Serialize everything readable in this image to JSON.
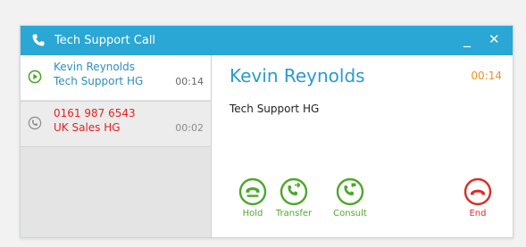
{
  "window": {
    "title": "Tech Support Call",
    "minimize_glyph": "_",
    "close_glyph": "✕"
  },
  "calls": [
    {
      "name": "Kevin Reynolds",
      "department": "Tech Support HG",
      "duration": "00:14",
      "state": "active",
      "icon": "play-circle-icon"
    },
    {
      "name": "0161 987 6543",
      "department": "UK Sales HG",
      "duration": "00:02",
      "state": "on-hold",
      "icon": "call-held-icon"
    }
  ],
  "current_call": {
    "name": "Kevin Reynolds",
    "duration": "00:14",
    "department": "Tech Support HG"
  },
  "actions": {
    "hold": "Hold",
    "transfer": "Transfer",
    "consult": "Consult",
    "end": "End"
  },
  "colors": {
    "titlebar": "#2aa7d4",
    "active_text": "#2a8fc0",
    "held_text": "#e82020",
    "timer": "#f09020",
    "action_green": "#4ea72c",
    "end_red": "#d63027"
  }
}
